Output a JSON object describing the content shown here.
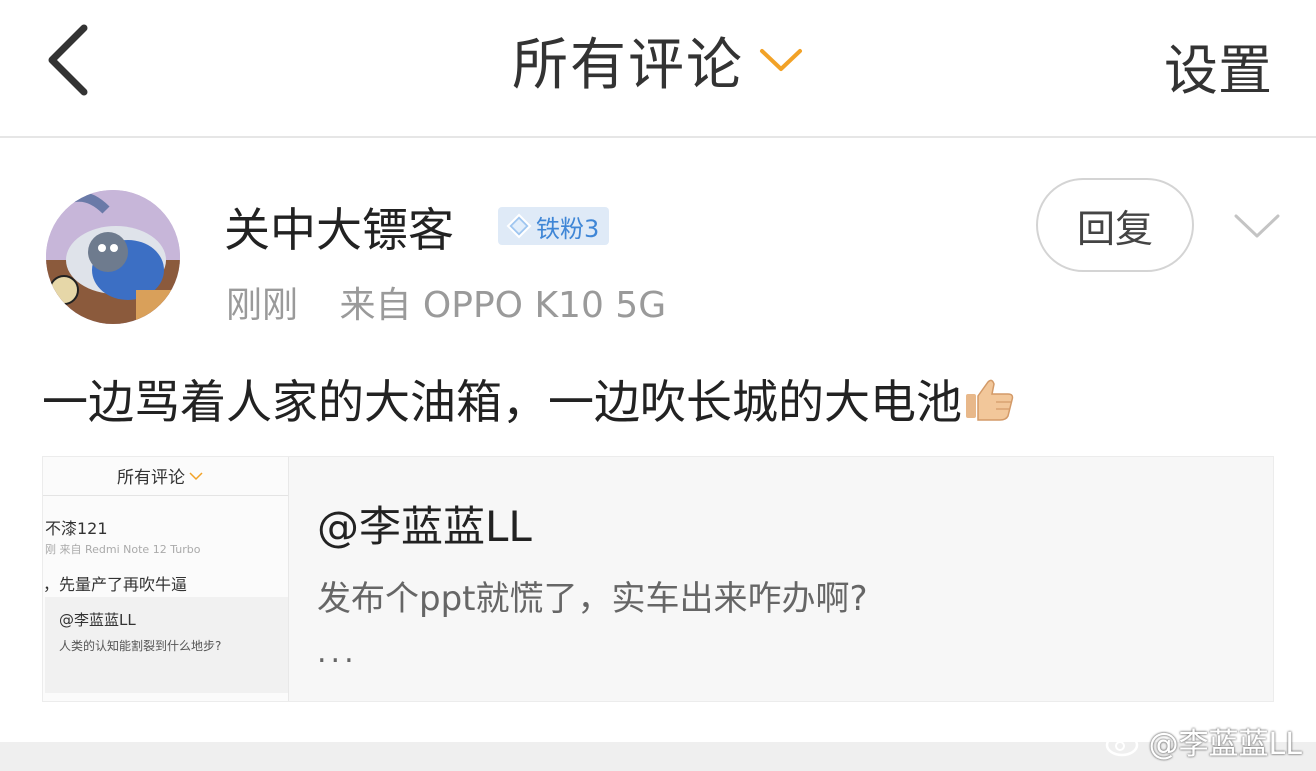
{
  "header": {
    "title": "所有评论",
    "settings_label": "设置",
    "accent_color": "#f2a227"
  },
  "comment": {
    "username": "关中大镖客",
    "badge": "铁粉3",
    "time": "刚刚",
    "source": "来自 OPPO K10 5G",
    "reply_label": "回复",
    "text": "一边骂着人家的大油箱，一边吹长城的大电池",
    "emoji": "thumbs-up-icon"
  },
  "quote": {
    "user": "@李蓝蓝LL",
    "text": "发布个ppt就慌了，实车出来咋办啊?",
    "ellipsis": "...",
    "thumbnail": {
      "title": "所有评论",
      "user": "不漆121",
      "meta": "刚  来自 Redmi Note 12 Turbo",
      "text": "，先量产了再吹牛逼",
      "inner_user": "@李蓝蓝LL",
      "inner_text": "人类的认知能割裂到什么地步?"
    }
  },
  "watermark": "@李蓝蓝LL"
}
